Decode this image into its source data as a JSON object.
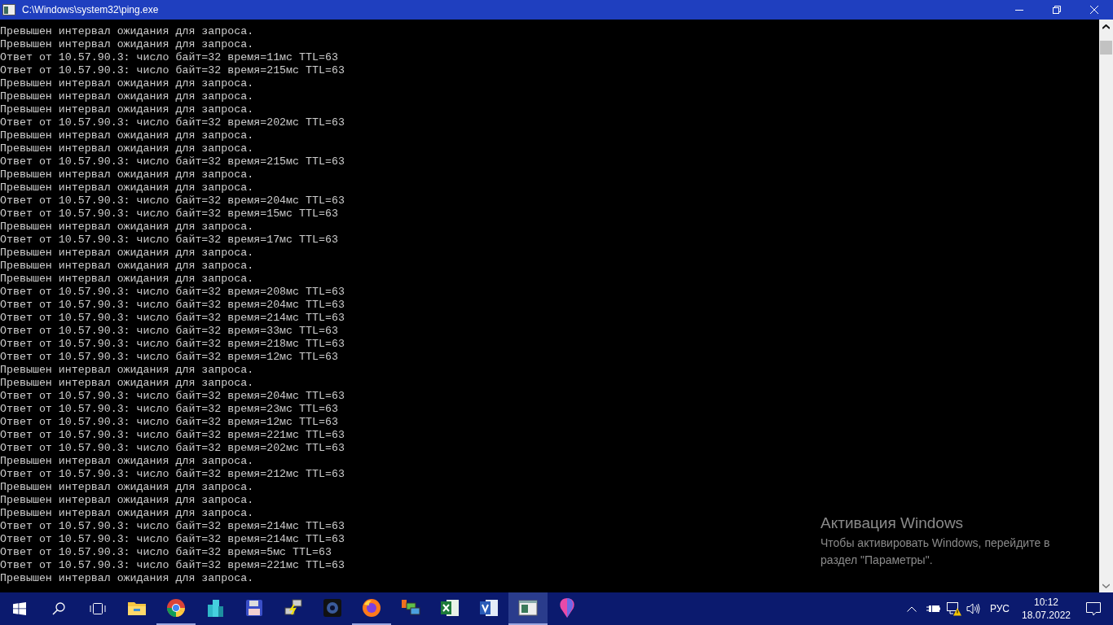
{
  "window": {
    "title": "C:\\Windows\\system32\\ping.exe"
  },
  "console_lines": [
    "Превышен интервал ожидания для запроса.",
    "Превышен интервал ожидания для запроса.",
    "Ответ от 10.57.90.3: число байт=32 время=11мс TTL=63",
    "Ответ от 10.57.90.3: число байт=32 время=215мс TTL=63",
    "Превышен интервал ожидания для запроса.",
    "Превышен интервал ожидания для запроса.",
    "Превышен интервал ожидания для запроса.",
    "Ответ от 10.57.90.3: число байт=32 время=202мс TTL=63",
    "Превышен интервал ожидания для запроса.",
    "Превышен интервал ожидания для запроса.",
    "Ответ от 10.57.90.3: число байт=32 время=215мс TTL=63",
    "Превышен интервал ожидания для запроса.",
    "Превышен интервал ожидания для запроса.",
    "Ответ от 10.57.90.3: число байт=32 время=204мс TTL=63",
    "Ответ от 10.57.90.3: число байт=32 время=15мс TTL=63",
    "Превышен интервал ожидания для запроса.",
    "Ответ от 10.57.90.3: число байт=32 время=17мс TTL=63",
    "Превышен интервал ожидания для запроса.",
    "Превышен интервал ожидания для запроса.",
    "Превышен интервал ожидания для запроса.",
    "Ответ от 10.57.90.3: число байт=32 время=208мс TTL=63",
    "Ответ от 10.57.90.3: число байт=32 время=204мс TTL=63",
    "Ответ от 10.57.90.3: число байт=32 время=214мс TTL=63",
    "Ответ от 10.57.90.3: число байт=32 время=33мс TTL=63",
    "Ответ от 10.57.90.3: число байт=32 время=218мс TTL=63",
    "Ответ от 10.57.90.3: число байт=32 время=12мс TTL=63",
    "Превышен интервал ожидания для запроса.",
    "Превышен интервал ожидания для запроса.",
    "Ответ от 10.57.90.3: число байт=32 время=204мс TTL=63",
    "Ответ от 10.57.90.3: число байт=32 время=23мс TTL=63",
    "Ответ от 10.57.90.3: число байт=32 время=12мс TTL=63",
    "Ответ от 10.57.90.3: число байт=32 время=221мс TTL=63",
    "Ответ от 10.57.90.3: число байт=32 время=202мс TTL=63",
    "Превышен интервал ожидания для запроса.",
    "Ответ от 10.57.90.3: число байт=32 время=212мс TTL=63",
    "Превышен интервал ожидания для запроса.",
    "Превышен интервал ожидания для запроса.",
    "Превышен интервал ожидания для запроса.",
    "Ответ от 10.57.90.3: число байт=32 время=214мс TTL=63",
    "Ответ от 10.57.90.3: число байт=32 время=214мс TTL=63",
    "Ответ от 10.57.90.3: число байт=32 время=5мс TTL=63",
    "Ответ от 10.57.90.3: число байт=32 время=221мс TTL=63",
    "Превышен интервал ожидания для запроса."
  ],
  "activation_notice": {
    "title": "Активация Windows",
    "text": "Чтобы активировать Windows, перейдите в раздел \"Параметры\"."
  },
  "taskbar": {
    "apps": [
      {
        "kind": "explorer",
        "running": false,
        "selected": false
      },
      {
        "kind": "chrome",
        "running": true,
        "selected": false
      },
      {
        "kind": "buildings",
        "running": false,
        "selected": false
      },
      {
        "kind": "floppy",
        "running": false,
        "selected": false
      },
      {
        "kind": "network",
        "running": false,
        "selected": false
      },
      {
        "kind": "camera",
        "running": false,
        "selected": false
      },
      {
        "kind": "firefox",
        "running": true,
        "selected": false
      },
      {
        "kind": "remote",
        "running": false,
        "selected": false
      },
      {
        "kind": "excel",
        "running": false,
        "selected": false
      },
      {
        "kind": "visio",
        "running": false,
        "selected": false
      },
      {
        "kind": "console",
        "running": true,
        "selected": true
      },
      {
        "kind": "balloon",
        "running": false,
        "selected": false
      }
    ],
    "language": "РУС",
    "time": "10:12",
    "date": "18.07.2022"
  }
}
